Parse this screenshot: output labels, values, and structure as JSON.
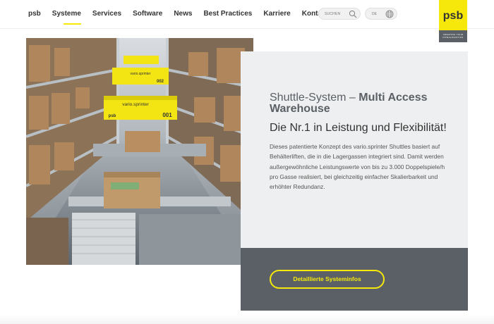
{
  "header": {
    "nav": [
      {
        "label": "psb",
        "active": false
      },
      {
        "label": "Systeme",
        "active": true
      },
      {
        "label": "Services",
        "active": false
      },
      {
        "label": "Software",
        "active": false
      },
      {
        "label": "News",
        "active": false
      },
      {
        "label": "Best Practices",
        "active": false
      },
      {
        "label": "Karriere",
        "active": false
      },
      {
        "label": "Kontakt",
        "active": false
      }
    ],
    "search_label": "SUCHEN",
    "search_icon": "search-icon",
    "lang_label": "DE",
    "lang_icon": "globe-icon",
    "logo_text": "psb",
    "logo_tagline": "CREATING YOUR INTRALOGISTICS"
  },
  "image": {
    "alt": "Shuttle-System vario.sprinter im Lagergang",
    "shuttle_brand": "vario.sprinter",
    "shuttle_numbers": [
      "001",
      "002"
    ],
    "shuttle_logo": "psb"
  },
  "content": {
    "title_light": "Shuttle-System – ",
    "title_bold": "Multi Access Warehouse",
    "subtitle": "Die Nr.1 in Leistung und Flexibilität!",
    "body": "Dieses patentierte Konzept des vario.sprinter Shuttles basiert auf Behälterliften, die in die Lagergassen integriert sind. Damit werden außergewöhnliche Leistungswerte von bis zu 3.000 Doppelspiele/h pro Gasse realisiert, bei gleichzeitig einfacher Skalierbarkeit und erhöhter Redundanz.",
    "cta_label": "Detaillierte Systeminfos"
  },
  "colors": {
    "accent": "#f5e80a",
    "panel_light": "#eeeff0",
    "panel_dark": "#5a6066"
  }
}
